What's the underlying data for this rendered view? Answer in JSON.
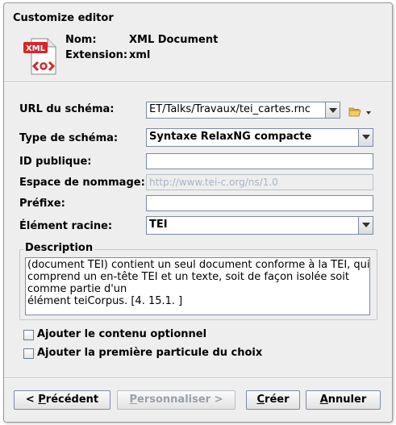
{
  "dialog": {
    "title": "Customize editor"
  },
  "file": {
    "icon_text": "XML",
    "name_label": "Nom:",
    "name_value": "XML Document",
    "ext_label": "Extension:",
    "ext_value": "xml"
  },
  "form": {
    "url_label": "URL du schéma:",
    "url_value": "ET/Talks/Travaux/tei_cartes.rnc",
    "type_label": "Type de schéma:",
    "type_value": "Syntaxe RelaxNG compacte",
    "public_id_label": "ID publique:",
    "public_id_value": "",
    "namespace_label": "Espace de nommage:",
    "namespace_value": "http://www.tei-c.org/ns/1.0",
    "prefix_label": "Préfixe:",
    "prefix_value": "",
    "root_label": "Élément racine:",
    "root_value": "TEI"
  },
  "description": {
    "legend": "Description",
    "lines": [
      "(document TEI) contient un seul document conforme à la TEI, qui",
      " comprend un en-tête TEI et un texte, soit de façon isolée soit",
      "comme partie d'un",
      " élément teiCorpus. [4. 15.1. ]"
    ]
  },
  "options": {
    "optional_label": "Ajouter le contenu optionnel",
    "optional_checked": false,
    "first_choice_label": "Ajouter la première particule du choix",
    "first_choice_checked": false
  },
  "buttons": {
    "previous": {
      "pre": "< ",
      "key": "P",
      "post": "récédent"
    },
    "customize": {
      "key": "P",
      "post": "ersonnaliser >"
    },
    "create": {
      "key": "C",
      "post": "réer"
    },
    "cancel": {
      "key": "A",
      "post": "nnuler"
    }
  },
  "colors": {
    "dialog_bg": "#eeeeee",
    "field_border": "#7a8aa8",
    "icon_red": "#d8262b",
    "disabled_text": "#a7b4c6"
  }
}
